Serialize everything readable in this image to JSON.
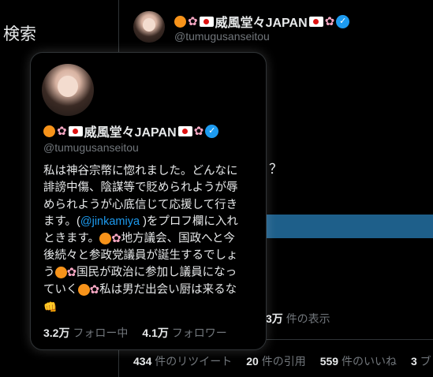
{
  "search": {
    "label": "検索"
  },
  "profile": {
    "name_text": "威風堂々JAPAN",
    "handle": "@tumugusanseitou"
  },
  "card": {
    "bio_lines": [
      "私は神谷宗幣に惚れました。どんなに",
      "誹謗中傷、陰謀等で貶められようが辱",
      "められようが心底信じて応援して行き",
      "ます。(",
      "@jinkamiya",
      " )をプロフ欄に入れ",
      "ときます。",
      "地方議会、国政へと今",
      "後続々と参政党議員が誕生するでしょ",
      "う",
      "国民が政治に参加し議員になっ",
      "ていく",
      "私は男だ出会い厨は来るな"
    ],
    "following_count": "3.2万",
    "following_label": "フォロー中",
    "followers_count": "4.1万",
    "followers_label": "フォロワー"
  },
  "tweet": {
    "question_fragment": "？",
    "views_count": "3万",
    "views_label": "件の表示",
    "retweets_count": "434",
    "retweets_label": "件のリツイート",
    "quotes_count": "20",
    "quotes_label": "件の引用",
    "likes_count": "559",
    "likes_label": "件のいいね",
    "bookmarks_count": "3",
    "bookmarks_label": "ブ"
  },
  "colors": {
    "accent": "#1d9bf0",
    "bg": "#000000",
    "muted": "#71767b",
    "bar": "#1e5f8a"
  },
  "icons": [
    "orange-circle-icon",
    "cherry-blossom-icon",
    "japan-flag-icon",
    "verified-badge-icon",
    "fist-icon"
  ]
}
